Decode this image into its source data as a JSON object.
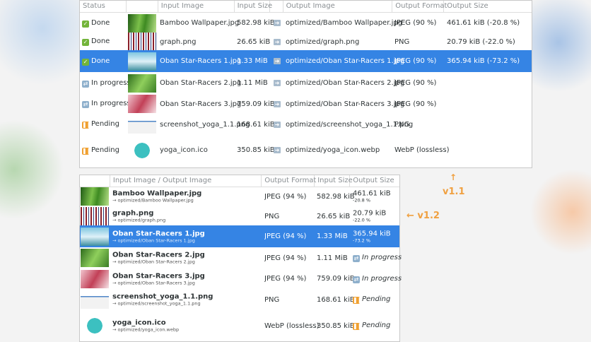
{
  "v11": {
    "headers": [
      "Status",
      "",
      "Input Image",
      "Input Size",
      "",
      "Output Image",
      "Output Format",
      "Output Size"
    ],
    "rows": [
      {
        "status": "Done",
        "status_icon": "check-icon",
        "thumb": "bamboo",
        "input": "Bamboo Wallpaper.jpg",
        "in_size": "582.98 kiB",
        "output": "optimized/Bamboo Wallpaper.jpg",
        "format": "JPEG (90 %)",
        "out_size": "461.61 kiB (-20.8 %)"
      },
      {
        "status": "Done",
        "status_icon": "check-icon",
        "thumb": "graph",
        "input": "graph.png",
        "in_size": "26.65 kiB",
        "output": "optimized/graph.png",
        "format": "PNG",
        "out_size": "20.79 kiB (-22.0 %)"
      },
      {
        "status": "Done",
        "status_icon": "check-icon",
        "thumb": "oban1",
        "input": "Oban Star-Racers 1.jpg",
        "in_size": "1.33 MiB",
        "output": "optimized/Oban Star-Racers 1.jpg",
        "format": "JPEG (90 %)",
        "out_size": "365.94 kiB (-73.2 %)",
        "selected": true
      },
      {
        "status": "In progress",
        "status_icon": "refresh-icon",
        "thumb": "oban2",
        "input": "Oban Star-Racers 2.jpg",
        "in_size": "1.11 MiB",
        "output": "optimized/Oban Star-Racers 2.jpg",
        "format": "JPEG (90 %)",
        "out_size": ""
      },
      {
        "status": "In progress",
        "status_icon": "refresh-icon",
        "thumb": "oban3",
        "input": "Oban Star-Racers 3.jpg",
        "in_size": "759.09 kiB",
        "output": "optimized/Oban Star-Racers 3.jpg",
        "format": "JPEG (90 %)",
        "out_size": ""
      },
      {
        "status": "Pending",
        "status_icon": "pause-icon",
        "thumb": "shot",
        "input": "screenshot_yoga_1.1.png",
        "in_size": "168.61 kiB",
        "output": "optimized/screenshot_yoga_1.1.png",
        "format": "PNG",
        "out_size": ""
      },
      {
        "status": "Pending",
        "status_icon": "pause-icon",
        "thumb": "yoga",
        "input": "yoga_icon.ico",
        "in_size": "350.85 kiB",
        "output": "optimized/yoga_icon.webp",
        "format": "WebP (lossless)",
        "out_size": ""
      }
    ]
  },
  "v12": {
    "headers": [
      "",
      "Input Image / Output Image",
      "Output Format",
      "Input Size",
      "Output Size"
    ],
    "rows": [
      {
        "thumb": "bamboo",
        "input": "Bamboo Wallpaper.jpg",
        "output": "→ optimized/Bamboo Wallpaper.jpg",
        "format": "JPEG (94 %)",
        "in_size": "582.98 kiB",
        "out_size": "461.61 kiB",
        "ratio": "-20.8 %"
      },
      {
        "thumb": "graph",
        "input": "graph.png",
        "output": "→ optimized/graph.png",
        "format": "PNG",
        "in_size": "26.65 kiB",
        "out_size": "20.79 kiB",
        "ratio": "-22.0 %"
      },
      {
        "thumb": "oban1",
        "input": "Oban Star-Racers 1.jpg",
        "output": "→ optimized/Oban Star-Racers 1.jpg",
        "format": "JPEG (94 %)",
        "in_size": "1.33 MiB",
        "out_size": "365.94 kiB",
        "ratio": "-73.2 %",
        "selected": true
      },
      {
        "thumb": "oban2",
        "input": "Oban Star-Racers 2.jpg",
        "output": "→ optimized/Oban Star-Racers 2.jpg",
        "format": "JPEG (94 %)",
        "in_size": "1.11 MiB",
        "status": "In progress",
        "status_icon": "refresh-icon"
      },
      {
        "thumb": "oban3",
        "input": "Oban Star-Racers 3.jpg",
        "output": "→ optimized/Oban Star-Racers 3.jpg",
        "format": "JPEG (94 %)",
        "in_size": "759.09 kiB",
        "status": "In progress",
        "status_icon": "refresh-icon"
      },
      {
        "thumb": "shot",
        "input": "screenshot_yoga_1.1.png",
        "output": "→ optimized/screenshot_yoga_1.1.png",
        "format": "PNG",
        "in_size": "168.61 kiB",
        "status": "Pending",
        "status_icon": "pause-icon"
      },
      {
        "thumb": "yoga",
        "input": "yoga_icon.ico",
        "output": "→ optimized/yoga_icon.webp",
        "format": "WebP (lossless)",
        "in_size": "350.85 kiB",
        "status": "Pending",
        "status_icon": "pause-icon"
      }
    ]
  },
  "annotations": {
    "v11_arrow": "↑",
    "v11": "v1.1",
    "v12": "← v1.2"
  },
  "colors": {
    "selection": "#3584e4",
    "accent": "#f0a040"
  }
}
